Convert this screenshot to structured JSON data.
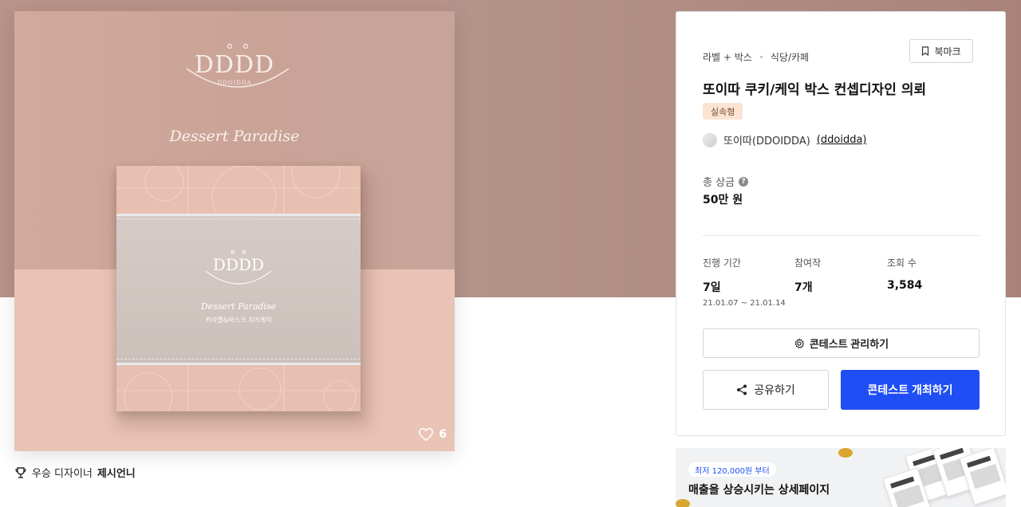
{
  "product": {
    "logo_text": "DDDD",
    "logo_sub": "DDOIDDA",
    "tagline": "Dessert Paradise",
    "box_logo_text": "DDDD",
    "box_tagline": "Dessert Paradise",
    "box_subtitle": "카라멜&바스크 치즈케익",
    "likes": "6"
  },
  "designer": {
    "prefix": "우승 디자이너",
    "name": "제시언니"
  },
  "panel": {
    "category_main": "라벨 + 박스",
    "category_sub": "식당/카페",
    "bookmark_label": "북마크",
    "title": "또이따 쿠키/케익 박스 컨셉디자인 의뢰",
    "type_badge": "실속형",
    "holder_name": "또이따(DDOIDDA)",
    "holder_handle": "(ddoidda)",
    "prize_label": "총 상금",
    "prize_help": "?",
    "prize_value": "50만 원",
    "stats": [
      {
        "label": "진행 기간",
        "value": "7일",
        "sub": "21.01.07  ~  21.01.14"
      },
      {
        "label": "참여작",
        "value": "7개",
        "sub": ""
      },
      {
        "label": "조회 수",
        "value": "3,584",
        "sub": ""
      }
    ],
    "manage_label": "콘테스트 관리하기",
    "share_label": "공유하기",
    "host_label": "콘테스트 개최하기"
  },
  "ad": {
    "pill": "최저 120,000원 부터",
    "title": "매출을 상승시키는 상세페이지"
  },
  "colors": {
    "accent": "#1f4ef5",
    "hero": "#b99488",
    "badge_bg": "#fbe4d4"
  }
}
